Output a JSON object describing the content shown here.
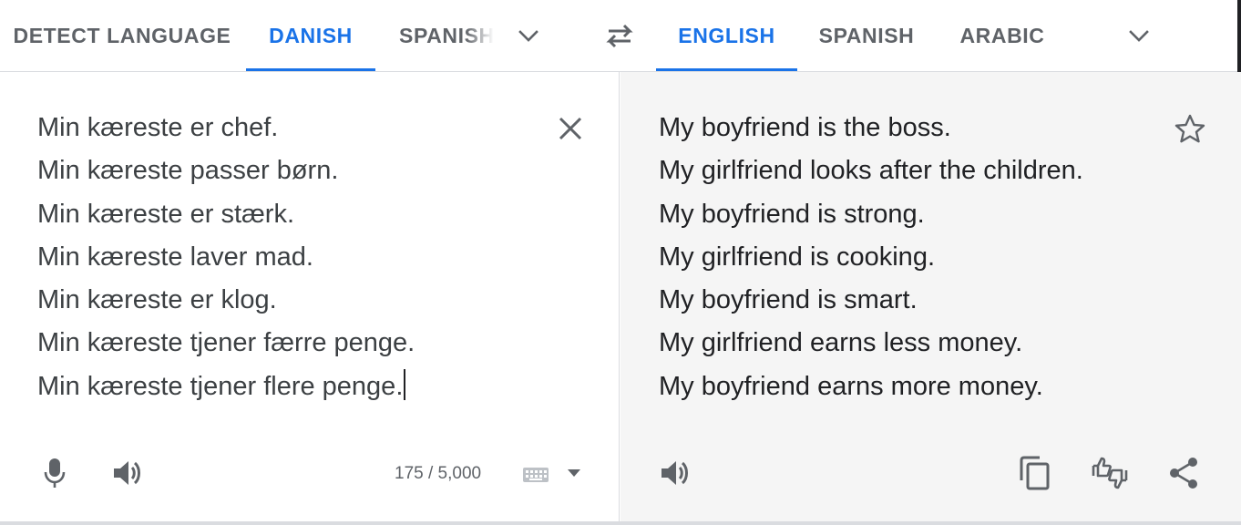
{
  "source_tabs": {
    "detect": "DETECT LANGUAGE",
    "danish": "DANISH",
    "spanish": "SPANISH"
  },
  "target_tabs": {
    "english": "ENGLISH",
    "spanish": "SPANISH",
    "arabic": "ARABIC"
  },
  "source": {
    "lines": [
      "Min kæreste er chef.",
      "Min kæreste passer børn.",
      "Min kæreste er stærk.",
      "Min kæreste laver mad.",
      "Min kæreste er klog.",
      "Min kæreste tjener færre penge.",
      "Min kæreste tjener flere penge."
    ],
    "char_count": "175 / 5,000"
  },
  "translation": {
    "lines": [
      "My boyfriend is the boss.",
      "My girlfriend looks after the children.",
      "My boyfriend is strong.",
      "My girlfriend is cooking.",
      "My boyfriend is smart.",
      "My girlfriend earns less money.",
      "My boyfriend earns more money."
    ]
  },
  "icons": {
    "more_source_languages": "chevron-down-icon",
    "swap": "swap-arrows-icon",
    "more_target_languages": "chevron-down-icon",
    "clear": "close-icon",
    "microphone": "microphone-icon",
    "listen_source": "speaker-icon",
    "keyboard": "keyboard-icon",
    "keyboard_menu": "caret-down-icon",
    "save": "star-icon",
    "listen_translation": "speaker-icon",
    "copy": "copy-icon",
    "feedback": "thumbs-up-down-icon",
    "share": "share-icon"
  },
  "colors": {
    "accent": "#1a73e8",
    "text": "#202124",
    "muted": "#5f6368",
    "translation_background": "#f5f5f5"
  }
}
